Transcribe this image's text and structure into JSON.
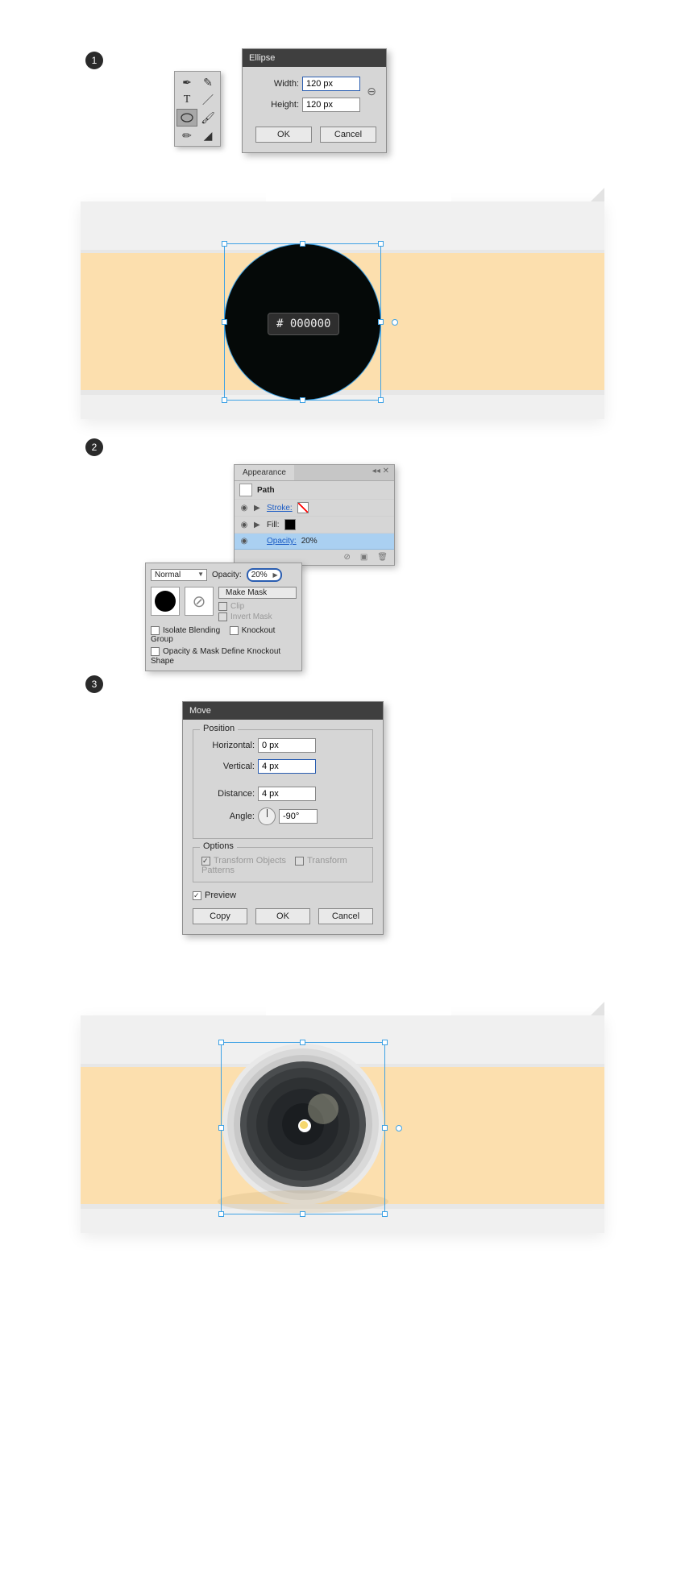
{
  "steps": {
    "s1": "1",
    "s2": "2",
    "s3": "3"
  },
  "ellipse": {
    "title": "Ellipse",
    "widthLabel": "Width:",
    "widthValue": "120 px",
    "heightLabel": "Height:",
    "heightValue": "120 px",
    "ok": "OK",
    "cancel": "Cancel"
  },
  "colorChip": "# 000000",
  "appearance": {
    "tab": "Appearance",
    "pathLabel": "Path",
    "strokeLabel": "Stroke:",
    "fillLabel": "Fill:",
    "opacityLabel": "Opacity:",
    "opacityValue": "20%"
  },
  "transparency": {
    "mode": "Normal",
    "opacityLabel": "Opacity:",
    "opacityValue": "20%",
    "makeMask": "Make Mask",
    "clip": "Clip",
    "invertMask": "Invert Mask",
    "isolate": "Isolate Blending",
    "knockout": "Knockout Group",
    "omdk": "Opacity & Mask Define Knockout Shape"
  },
  "move": {
    "title": "Move",
    "position": "Position",
    "horizontalLabel": "Horizontal:",
    "horizontalValue": "0 px",
    "verticalLabel": "Vertical:",
    "verticalValue": "4 px",
    "distanceLabel": "Distance:",
    "distanceValue": "4 px",
    "angleLabel": "Angle:",
    "angleValue": "-90°",
    "options": "Options",
    "transformObjects": "Transform Objects",
    "transformPatterns": "Transform Patterns",
    "preview": "Preview",
    "copy": "Copy",
    "ok": "OK",
    "cancel": "Cancel"
  }
}
